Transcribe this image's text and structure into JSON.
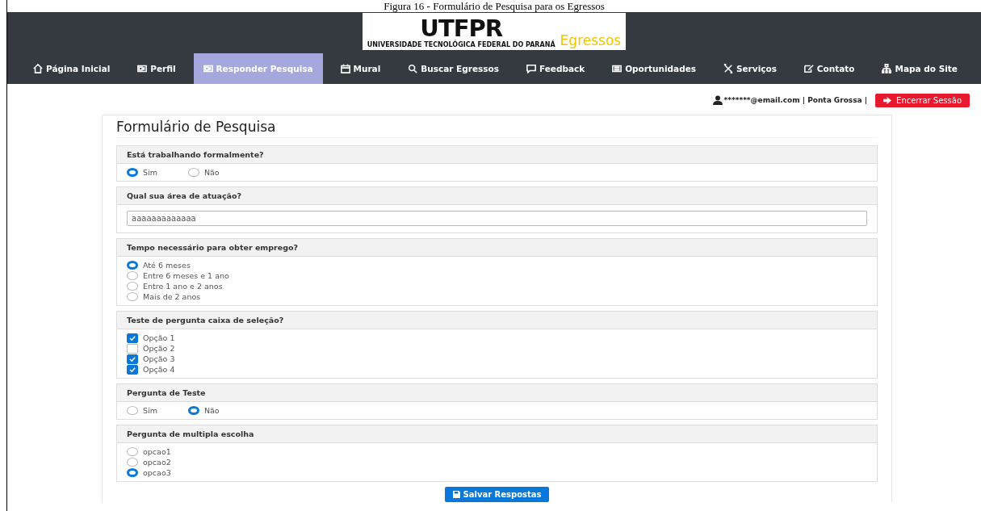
{
  "caption": "Figura 16 - Formulário de Pesquisa para os Egressos",
  "logo": {
    "mark": "UTFPR",
    "university": "UNIVERSIDADE TECNOLÓGICA FEDERAL DO PARANÁ",
    "product": "Egressos"
  },
  "nav": [
    {
      "label": "Página Inicial",
      "selected": false
    },
    {
      "label": "Perfil",
      "selected": false
    },
    {
      "label": "Responder Pesquisa",
      "selected": true
    },
    {
      "label": "Mural",
      "selected": false
    },
    {
      "label": "Buscar Egressos",
      "selected": false
    },
    {
      "label": "Feedback",
      "selected": false
    },
    {
      "label": "Oportunidades",
      "selected": false
    },
    {
      "label": "Serviços",
      "selected": false
    },
    {
      "label": "Contato",
      "selected": false
    },
    {
      "label": "Mapa do Site",
      "selected": false
    }
  ],
  "user": {
    "info": "*******@email.com | Ponta Grossa |",
    "logout": "Encerrar Sessão"
  },
  "form": {
    "title": "Formulário de Pesquisa",
    "questions": [
      {
        "kind": "radio-inline",
        "question": "Está trabalhando formalmente?",
        "options": [
          {
            "label": "Sim",
            "selected": true
          },
          {
            "label": "Não",
            "selected": false
          }
        ]
      },
      {
        "kind": "text",
        "question": "Qual sua área de atuação?",
        "value": "aaaaaaaaaaaaa"
      },
      {
        "kind": "radio-list",
        "question": "Tempo necessário para obter emprego?",
        "options": [
          {
            "label": "Até 6 meses",
            "selected": true
          },
          {
            "label": "Entre 6 meses e 1 ano",
            "selected": false
          },
          {
            "label": "Entre 1 ano e 2 anos",
            "selected": false
          },
          {
            "label": "Mais de 2 anos",
            "selected": false
          }
        ]
      },
      {
        "kind": "checkbox-list",
        "question": "Teste de pergunta caixa de seleção?",
        "options": [
          {
            "label": "Opção 1",
            "checked": true
          },
          {
            "label": "Opção 2",
            "checked": false
          },
          {
            "label": "Opção 3",
            "checked": true
          },
          {
            "label": "Opção 4",
            "checked": true
          }
        ]
      },
      {
        "kind": "radio-inline",
        "question": "Pergunta de Teste",
        "options": [
          {
            "label": "Sim",
            "selected": false
          },
          {
            "label": "Não",
            "selected": true
          }
        ]
      },
      {
        "kind": "radio-list",
        "question": "Pergunta de multipla escolha",
        "options": [
          {
            "label": "opcao1",
            "selected": false
          },
          {
            "label": "opcao2",
            "selected": false
          },
          {
            "label": "opcao3",
            "selected": true
          }
        ]
      }
    ],
    "submit": "Salvar Respostas"
  }
}
